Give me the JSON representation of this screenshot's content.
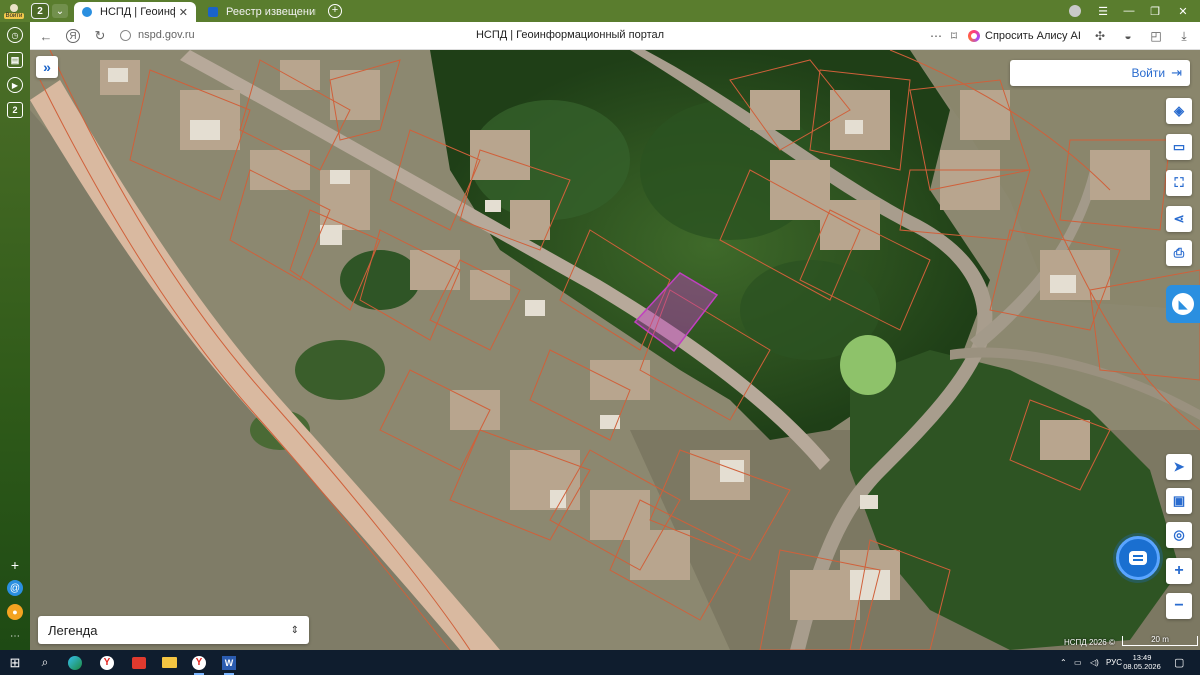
{
  "browser": {
    "profile_label": "Войти",
    "tab_count": "2",
    "tabs": [
      {
        "title": "НСПД | Геоинформационный портал",
        "favicon_color": "#2a8fe0"
      },
      {
        "title": "Реестр извещений",
        "favicon_color": "#1a63c9"
      }
    ],
    "url": "nspd.gov.ru",
    "page_title": "НСПД | Геоинформационный портал",
    "alice_label": "Спросить Алису AI",
    "sidebar_items": [
      "2"
    ]
  },
  "map": {
    "login_label": "Войти",
    "legend_label": "Легенда",
    "attribution": "НСПД 2026 ©",
    "scale": "20 m",
    "selected_parcel_color": "#c040c0",
    "boundary_color": "#d0603a",
    "tools": [
      "layers-icon",
      "ruler-icon",
      "zoom-to-area-icon",
      "share-icon",
      "print-icon"
    ],
    "bottom_tools": [
      "navigate-icon",
      "map-layout-icon",
      "location-icon",
      "zoom-in-icon",
      "zoom-out-icon"
    ],
    "zoom_in": "+",
    "zoom_out": "−"
  },
  "taskbar": {
    "language": "РУС",
    "time": "13:49",
    "date": "08.05.2026"
  }
}
